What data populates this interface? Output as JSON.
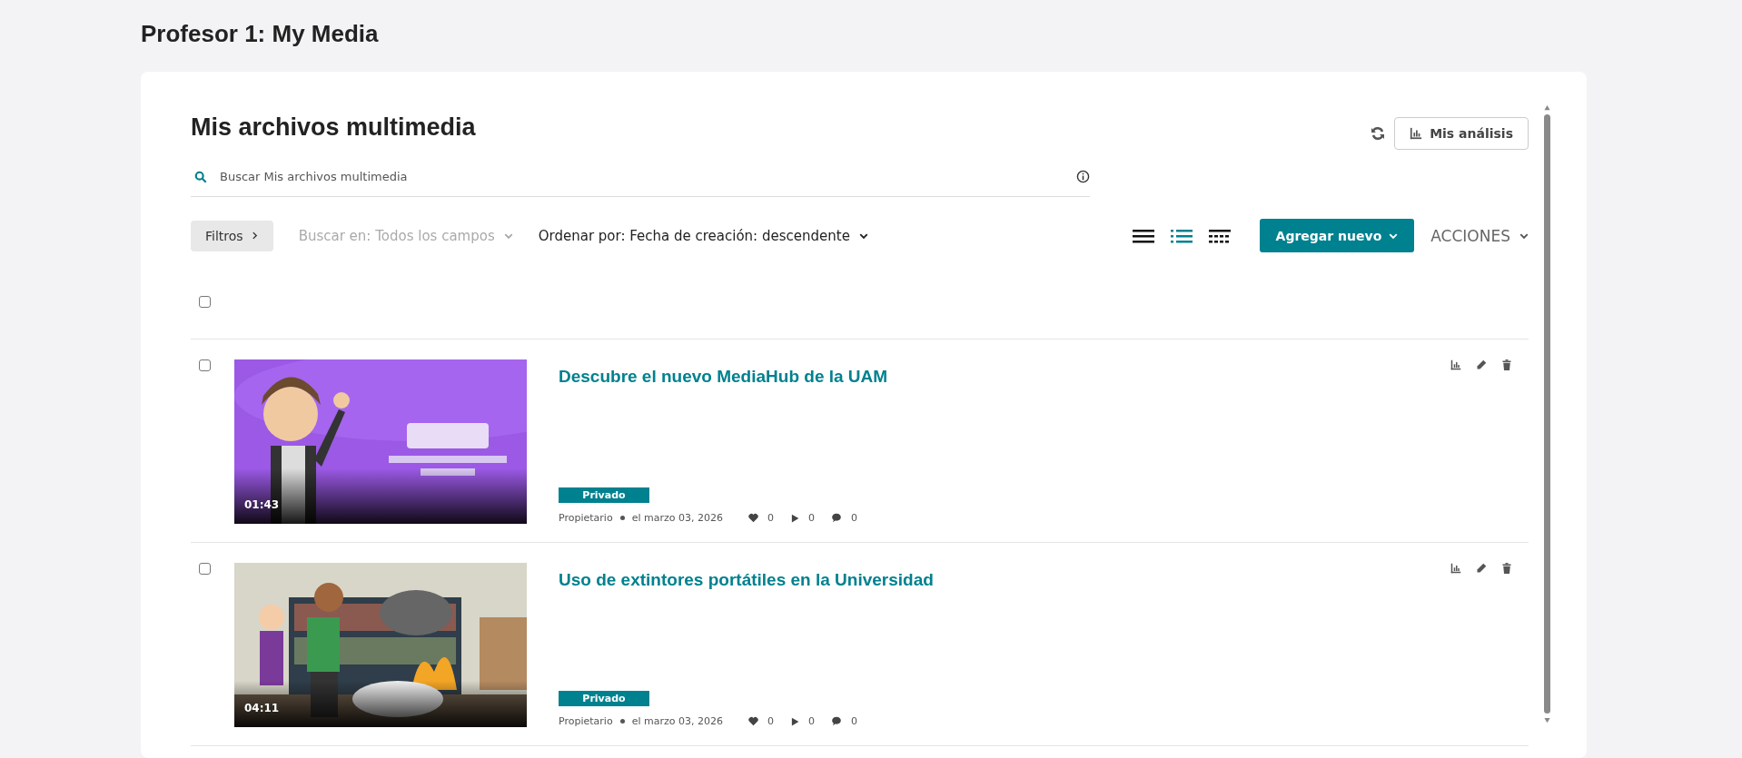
{
  "page_title": "Profesor 1: My Media",
  "panel": {
    "title": "Mis archivos multimedia",
    "analytics_button": "Mis análisis",
    "search": {
      "placeholder": "Buscar Mis archivos multimedia"
    },
    "filters_button": "Filtros",
    "search_in": {
      "label": "Buscar en: Todos los campos",
      "disabled": true
    },
    "sort": {
      "label": "Ordenar por: Fecha de creación: descendente",
      "disabled": false
    },
    "views": [
      {
        "kind": "list",
        "selected": false
      },
      {
        "kind": "detailed",
        "selected": true
      },
      {
        "kind": "grid",
        "selected": false
      }
    ],
    "add_button": "Agregar nuevo",
    "actions_menu": "ACCIONES",
    "select_all": {
      "checked": false
    },
    "entries": [
      {
        "title": "Descubre el nuevo MediaHub de la UAM",
        "duration": "01:43",
        "status": "Privado",
        "owner": "Propietario",
        "date": "el marzo 03, 2026",
        "likes": "0",
        "plays": "0",
        "comments": "0",
        "checked": false
      },
      {
        "title": "Uso de extintores portátiles en la Universidad",
        "duration": "04:11",
        "status": "Privado",
        "owner": "Propietario",
        "date": "el marzo 03, 2026",
        "likes": "0",
        "plays": "0",
        "comments": "0",
        "checked": false
      }
    ]
  }
}
